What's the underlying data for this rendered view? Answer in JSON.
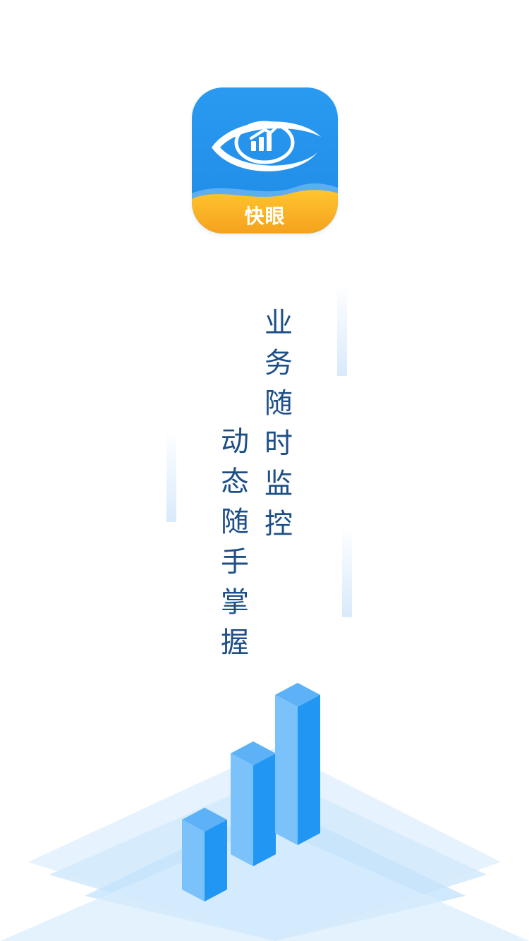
{
  "app": {
    "name": "快眼",
    "icon": "eye-chart-logo-icon"
  },
  "slogans": {
    "line1": "业务随时监控",
    "line2": "动态随手掌握"
  },
  "illustration": {
    "icon": "3d-bar-chart-icon"
  },
  "colors": {
    "icon_blue": "#2a9af0",
    "icon_orange": "#f6a623",
    "slogan_text": "#1d4f86",
    "bar_blue": "#2196f3",
    "platform_blue": "#cfe6fb"
  }
}
